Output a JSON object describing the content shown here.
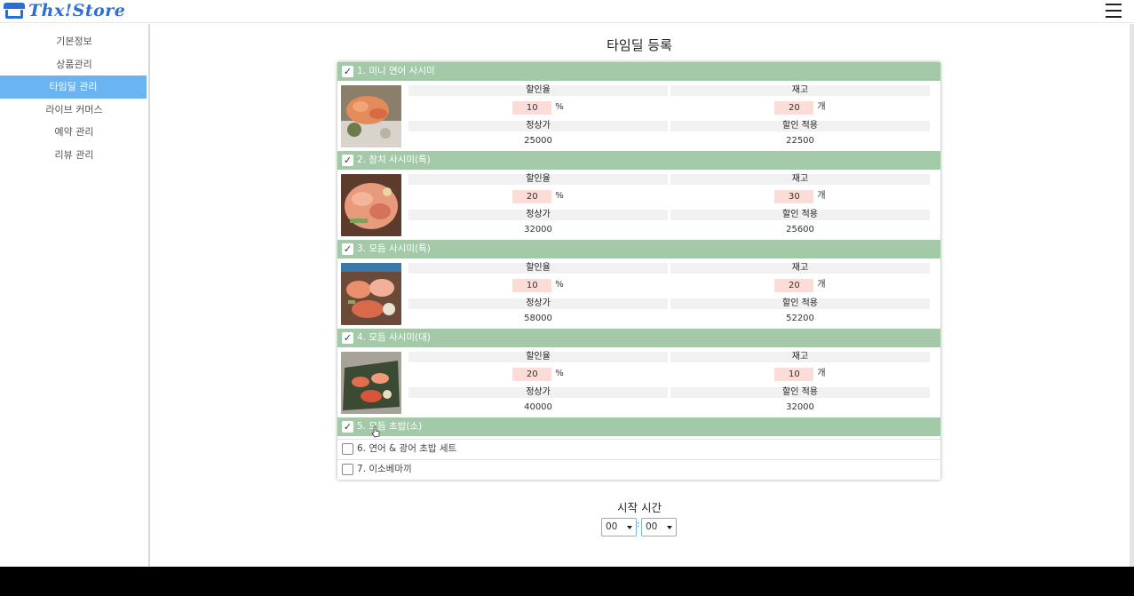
{
  "app": {
    "logo_text": "Thx!Store"
  },
  "sidebar": {
    "items": [
      {
        "label": "기본정보",
        "active": false
      },
      {
        "label": "상품관리",
        "active": false
      },
      {
        "label": "타임딜 관리",
        "active": true
      },
      {
        "label": "라이브 커머스",
        "active": false
      },
      {
        "label": "예약 관리",
        "active": false
      },
      {
        "label": "리뷰 관리",
        "active": false
      }
    ]
  },
  "main": {
    "title": "타임딜 등록",
    "columns": {
      "discount_rate": "할인율",
      "stock": "재고",
      "regular_price": "정상가",
      "discounted_price": "할인 적용"
    },
    "units": {
      "percent": "%",
      "count": "개"
    },
    "products": [
      {
        "label": "1. 미니 연어 사시미",
        "checked": true,
        "discount": "10",
        "stock": "20",
        "price": "25000",
        "sale_price": "22500"
      },
      {
        "label": "2. 참치 사시미(특)",
        "checked": true,
        "discount": "20",
        "stock": "30",
        "price": "32000",
        "sale_price": "25600"
      },
      {
        "label": "3. 모듬 사시미(특)",
        "checked": true,
        "discount": "10",
        "stock": "20",
        "price": "58000",
        "sale_price": "52200"
      },
      {
        "label": "4. 모듬 사시미(대)",
        "checked": true,
        "discount": "20",
        "stock": "10",
        "price": "40000",
        "sale_price": "32000"
      },
      {
        "label": "5. 모듬 초밥(소)",
        "checked": true
      },
      {
        "label": "6. 연어 & 광어 초밥 세트",
        "checked": false
      },
      {
        "label": "7. 이소베마끼",
        "checked": false
      }
    ],
    "start_time": {
      "label": "시작 시간",
      "hour": "00",
      "minute": "00",
      "separator": ":"
    }
  },
  "colors": {
    "accent": "#2a6fd6",
    "sidebar_active": "#6ab4f2",
    "item_header": "#a3c9a8",
    "input_bg": "#fbdcd6"
  }
}
